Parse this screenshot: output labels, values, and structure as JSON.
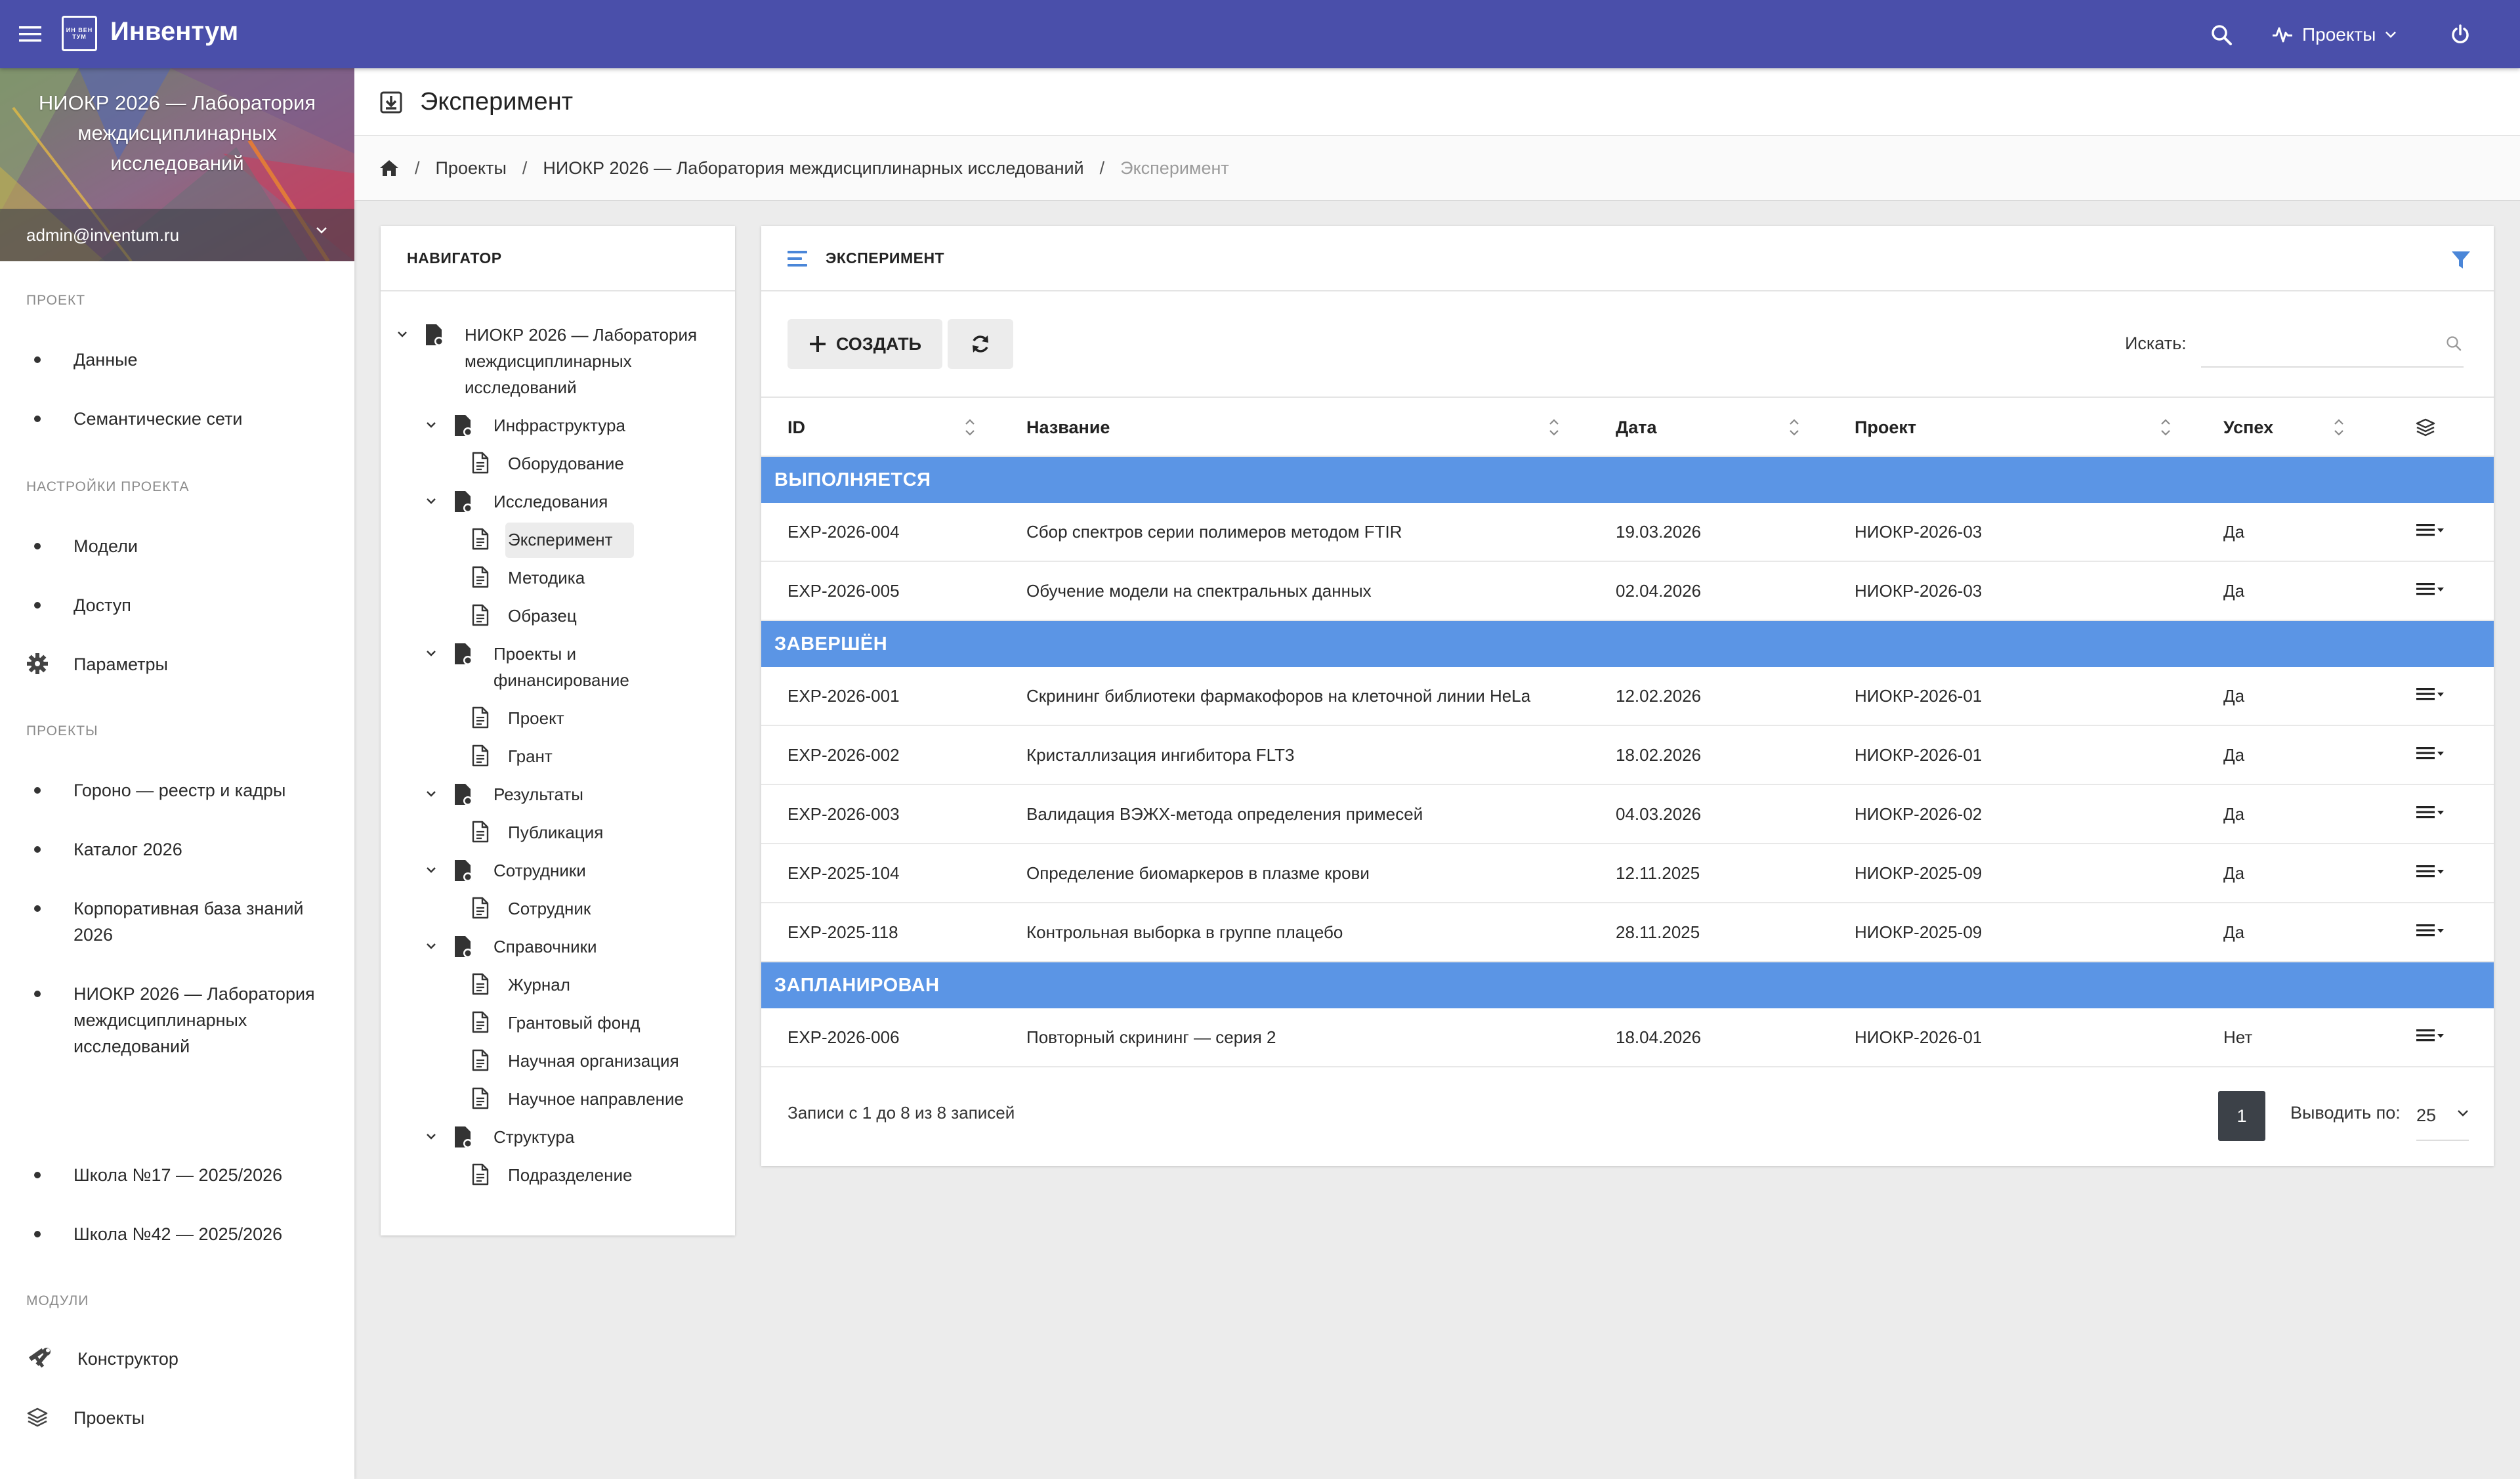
{
  "topbar": {
    "logo_text": "ИН ВЕН ТУМ",
    "brand": "Инвентум",
    "projects_label": "Проекты",
    "accent": "#4a4faa"
  },
  "sidebar": {
    "header_title": "НИОКР 2026 — Лаборатория междисциплинарных исследований",
    "user_email": "admin@inventum.ru",
    "section_project": "ПРОЕКТ",
    "project_items": [
      "Данные",
      "Семантические сети"
    ],
    "section_settings": "НАСТРОЙКИ ПРОЕКТА",
    "settings_items": [
      "Модели",
      "Доступ",
      "Параметры"
    ],
    "section_projects": "ПРОЕКТЫ",
    "projects_items": [
      "Гороно — реестр и кадры",
      "Каталог 2026",
      "Корпоративная база знаний 2026",
      "НИОКР 2026 — Лаборатория междисциплинарных исследований",
      "Школа №17 — 2025/2026",
      "Школа №42 — 2025/2026"
    ],
    "section_modules": "МОДУЛИ",
    "modules_items": [
      "Конструктор",
      "Проекты"
    ]
  },
  "page": {
    "title": "Эксперимент"
  },
  "breadcrumb": {
    "projects": "Проекты",
    "project": "НИОКР 2026 — Лаборатория междисциплинарных исследований",
    "current": "Эксперимент",
    "separator": "/"
  },
  "navigator": {
    "title": "НАВИГАТОР",
    "root": "НИОКР 2026 — Лаборатория междисциплинарных исследований",
    "groups": [
      {
        "label": "Инфраструктура",
        "children": [
          "Оборудование"
        ]
      },
      {
        "label": "Исследования",
        "children": [
          "Эксперимент",
          "Методика",
          "Образец"
        ]
      },
      {
        "label": "Проекты и финансирование",
        "children": [
          "Проект",
          "Грант"
        ]
      },
      {
        "label": "Результаты",
        "children": [
          "Публикация"
        ]
      },
      {
        "label": "Сотрудники",
        "children": [
          "Сотрудник"
        ]
      },
      {
        "label": "Справочники",
        "children": [
          "Журнал",
          "Грантовый фонд",
          "Научная организация",
          "Научное направление"
        ]
      },
      {
        "label": "Структура",
        "children": [
          "Подразделение"
        ]
      }
    ],
    "selected": "Эксперимент"
  },
  "table": {
    "title": "ЭКСПЕРИМЕНТ",
    "create_label": "СОЗДАТЬ",
    "search_label": "Искать:",
    "search_value": "",
    "search_placeholder": "",
    "columns": [
      "ID",
      "Название",
      "Дата",
      "Проект",
      "Успех"
    ],
    "group_color": "#5b95e5",
    "groups": [
      {
        "name": "ВЫПОЛНЯЕТСЯ",
        "rows": [
          [
            "EXP-2026-004",
            "Сбор спектров серии полимеров методом FTIR",
            "19.03.2026",
            "НИОКР-2026-03",
            "Да"
          ],
          [
            "EXP-2026-005",
            "Обучение модели на спектральных данных",
            "02.04.2026",
            "НИОКР-2026-03",
            "Да"
          ]
        ]
      },
      {
        "name": "ЗАВЕРШЁН",
        "rows": [
          [
            "EXP-2026-001",
            "Скрининг библиотеки фармакофоров на клеточной линии HeLa",
            "12.02.2026",
            "НИОКР-2026-01",
            "Да"
          ],
          [
            "EXP-2026-002",
            "Кристаллизация ингибитора FLT3",
            "18.02.2026",
            "НИОКР-2026-01",
            "Да"
          ],
          [
            "EXP-2026-003",
            "Валидация ВЭЖХ-метода определения примесей",
            "04.03.2026",
            "НИОКР-2026-02",
            "Да"
          ],
          [
            "EXP-2025-104",
            "Определение биомаркеров в плазме крови",
            "12.11.2025",
            "НИОКР-2025-09",
            "Да"
          ],
          [
            "EXP-2025-118",
            "Контрольная выборка в группе плацебо",
            "28.11.2025",
            "НИОКР-2025-09",
            "Да"
          ]
        ]
      },
      {
        "name": "ЗАПЛАНИРОВАН",
        "rows": [
          [
            "EXP-2026-006",
            "Повторный скрининг — серия 2",
            "18.04.2026",
            "НИОКР-2026-01",
            "Нет"
          ]
        ]
      }
    ],
    "footer_info": "Записи с 1 до 8 из 8 записей",
    "current_page": "1",
    "per_page_label": "Выводить по:",
    "per_page_value": "25"
  }
}
